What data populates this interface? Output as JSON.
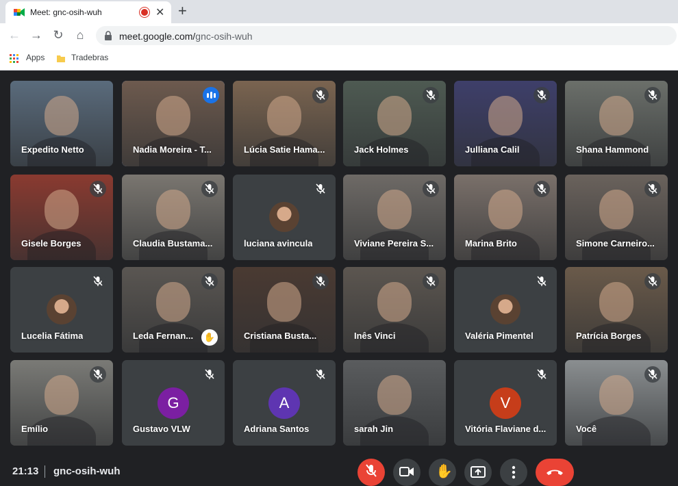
{
  "browser": {
    "tab_title": "Meet: gnc-osih-wuh",
    "url_host": "meet.google.com/",
    "url_path": "gnc-osih-wuh",
    "bookmarks": [
      "Apps",
      "Tradebras"
    ]
  },
  "participants": [
    {
      "name": "Expedito Netto",
      "state": "camera",
      "speaking": false,
      "muted": false
    },
    {
      "name": "Nadia Moreira - T...",
      "state": "camera",
      "speaking": true,
      "muted": false
    },
    {
      "name": "Lúcia Satie Hama...",
      "state": "camera",
      "speaking": false,
      "muted": true
    },
    {
      "name": "Jack Holmes",
      "state": "camera",
      "speaking": false,
      "muted": true
    },
    {
      "name": "Julliana Calil",
      "state": "camera",
      "speaking": false,
      "muted": true
    },
    {
      "name": "Shana Hammond",
      "state": "camera",
      "speaking": false,
      "muted": true
    },
    {
      "name": "Gisele Borges",
      "state": "camera",
      "speaking": false,
      "muted": true
    },
    {
      "name": "Claudia Bustama...",
      "state": "camera",
      "speaking": false,
      "muted": true
    },
    {
      "name": "luciana avincula",
      "state": "avatar",
      "speaking": false,
      "muted": true
    },
    {
      "name": "Viviane Pereira S...",
      "state": "camera",
      "speaking": false,
      "muted": true
    },
    {
      "name": "Marina Brito",
      "state": "camera",
      "speaking": false,
      "muted": true
    },
    {
      "name": "Simone Carneiro...",
      "state": "camera",
      "speaking": false,
      "muted": true
    },
    {
      "name": "Lucelia Fátima",
      "state": "avatar",
      "speaking": false,
      "muted": true
    },
    {
      "name": "Leda Fernan...",
      "state": "camera",
      "speaking": false,
      "muted": true,
      "hand_raised": true
    },
    {
      "name": "Cristiana Busta...",
      "state": "camera",
      "speaking": false,
      "muted": true
    },
    {
      "name": "Inês Vinci",
      "state": "camera",
      "speaking": false,
      "muted": true
    },
    {
      "name": "Valéria Pimentel",
      "state": "avatar",
      "speaking": false,
      "muted": true
    },
    {
      "name": "Patrícia Borges",
      "state": "camera",
      "speaking": false,
      "muted": true
    },
    {
      "name": "Emílio",
      "state": "camera",
      "speaking": false,
      "muted": true
    },
    {
      "name": "Gustavo VLW",
      "state": "letter",
      "letter": "G",
      "color": "#7b1fa2",
      "muted": true
    },
    {
      "name": "Adriana Santos",
      "state": "letter",
      "letter": "A",
      "color": "#5e35b1",
      "muted": true
    },
    {
      "name": "sarah Jin",
      "state": "camera",
      "speaking": false,
      "muted": false
    },
    {
      "name": "Vitória Flaviane d...",
      "state": "letter",
      "letter": "V",
      "color": "#c63d1a",
      "muted": true
    },
    {
      "name": "Você",
      "state": "camera",
      "speaking": false,
      "muted": true
    }
  ],
  "meeting": {
    "time": "21:13",
    "code": "gnc-osih-wuh"
  },
  "colors": {
    "background": "#202124",
    "tile": "#3c4043",
    "accent": "#8ab4f8",
    "danger": "#ea4335"
  }
}
